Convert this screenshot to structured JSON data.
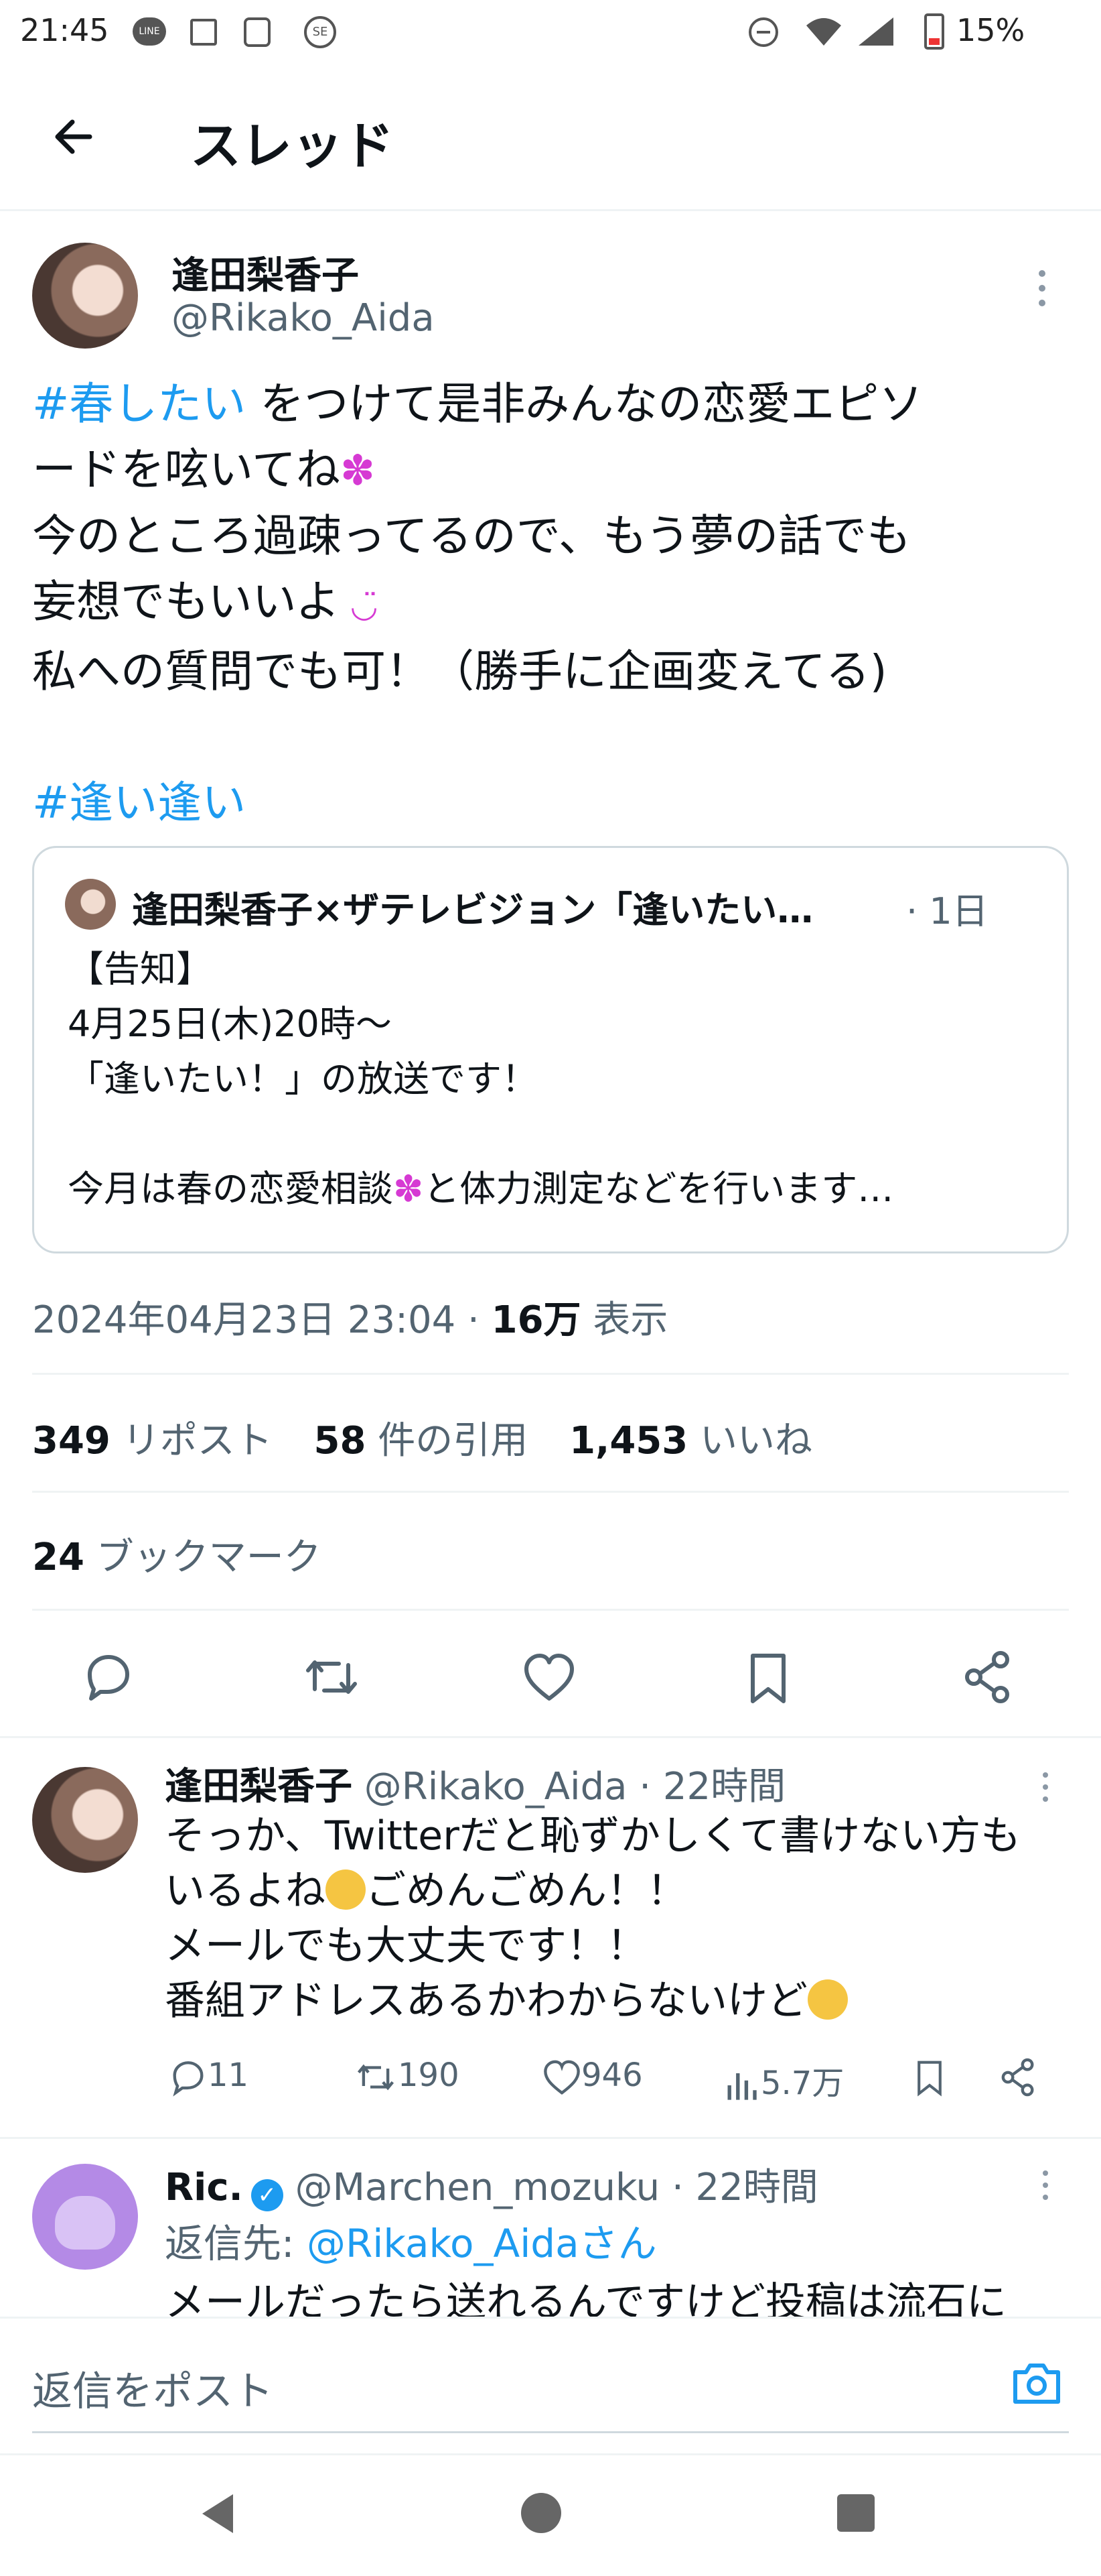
{
  "status_bar": {
    "time": "21:45",
    "battery": "15%"
  },
  "header": {
    "title": "スレッド"
  },
  "tweet": {
    "author_name": "逢田梨香子",
    "author_handle": "@Rikako_Aida",
    "hashtag1": "#春したい",
    "line1_rest": " をつけて是非みんなの恋愛エピソ",
    "line2": "ードを呟いてね",
    "line3": "今のところ過疎ってるので、もう夢の話でも",
    "line4": "妄想でもいいよ",
    "line5": "私への質問でも可！（勝手に企画変えてる)",
    "hashtag2": "#逢い逢い",
    "quote": {
      "author": "逢田梨香子×ザテレビジョン「逢いたい…",
      "time": "· 1日",
      "line1": "【告知】",
      "line2": "4月25日(木)20時〜",
      "line3": "「逢いたい！」の放送です！",
      "line4": "今月は春の恋愛相談",
      "line4_rest": "と体力測定などを行います…"
    },
    "timestamp": "2024年04月23日 23:04 · ",
    "views_count": "16万",
    "views_label": " 表示",
    "stats": {
      "reposts_count": "349",
      "reposts_label": " リポスト",
      "quotes_count": "58",
      "quotes_label": " 件の引用",
      "likes_count": "1,453",
      "likes_label": " いいね",
      "bookmarks_count": "24",
      "bookmarks_label": " ブックマーク"
    }
  },
  "reply1": {
    "author_name": "逢田梨香子",
    "meta": " @Rikako_Aida · 22時間",
    "line1": "そっか、Twitterだと恥ずかしくて書けない方も",
    "line2": "いるよね",
    "line2_rest": "ごめんごめん！！",
    "line3": "メールでも大丈夫です！！",
    "line4": "番組アドレスあるかわからないけど",
    "replies": "11",
    "reposts": "190",
    "likes": "946",
    "views": "5.7万"
  },
  "reply2": {
    "author_name": "Ric.",
    "meta": " @Marchen_mozuku · 22時間",
    "reply_to_label": "返信先: ",
    "reply_to_handle": "@Rikako_Aidaさん",
    "line1": "メールだったら送れるんですけど投稿は流石に"
  },
  "composer": {
    "placeholder": "返信をポスト"
  },
  "colors": {
    "accent": "#1d9bf0",
    "text": "#0f1419",
    "muted": "#536471",
    "divider": "#eff3f4",
    "emoji_pink": "#d63ad3"
  }
}
